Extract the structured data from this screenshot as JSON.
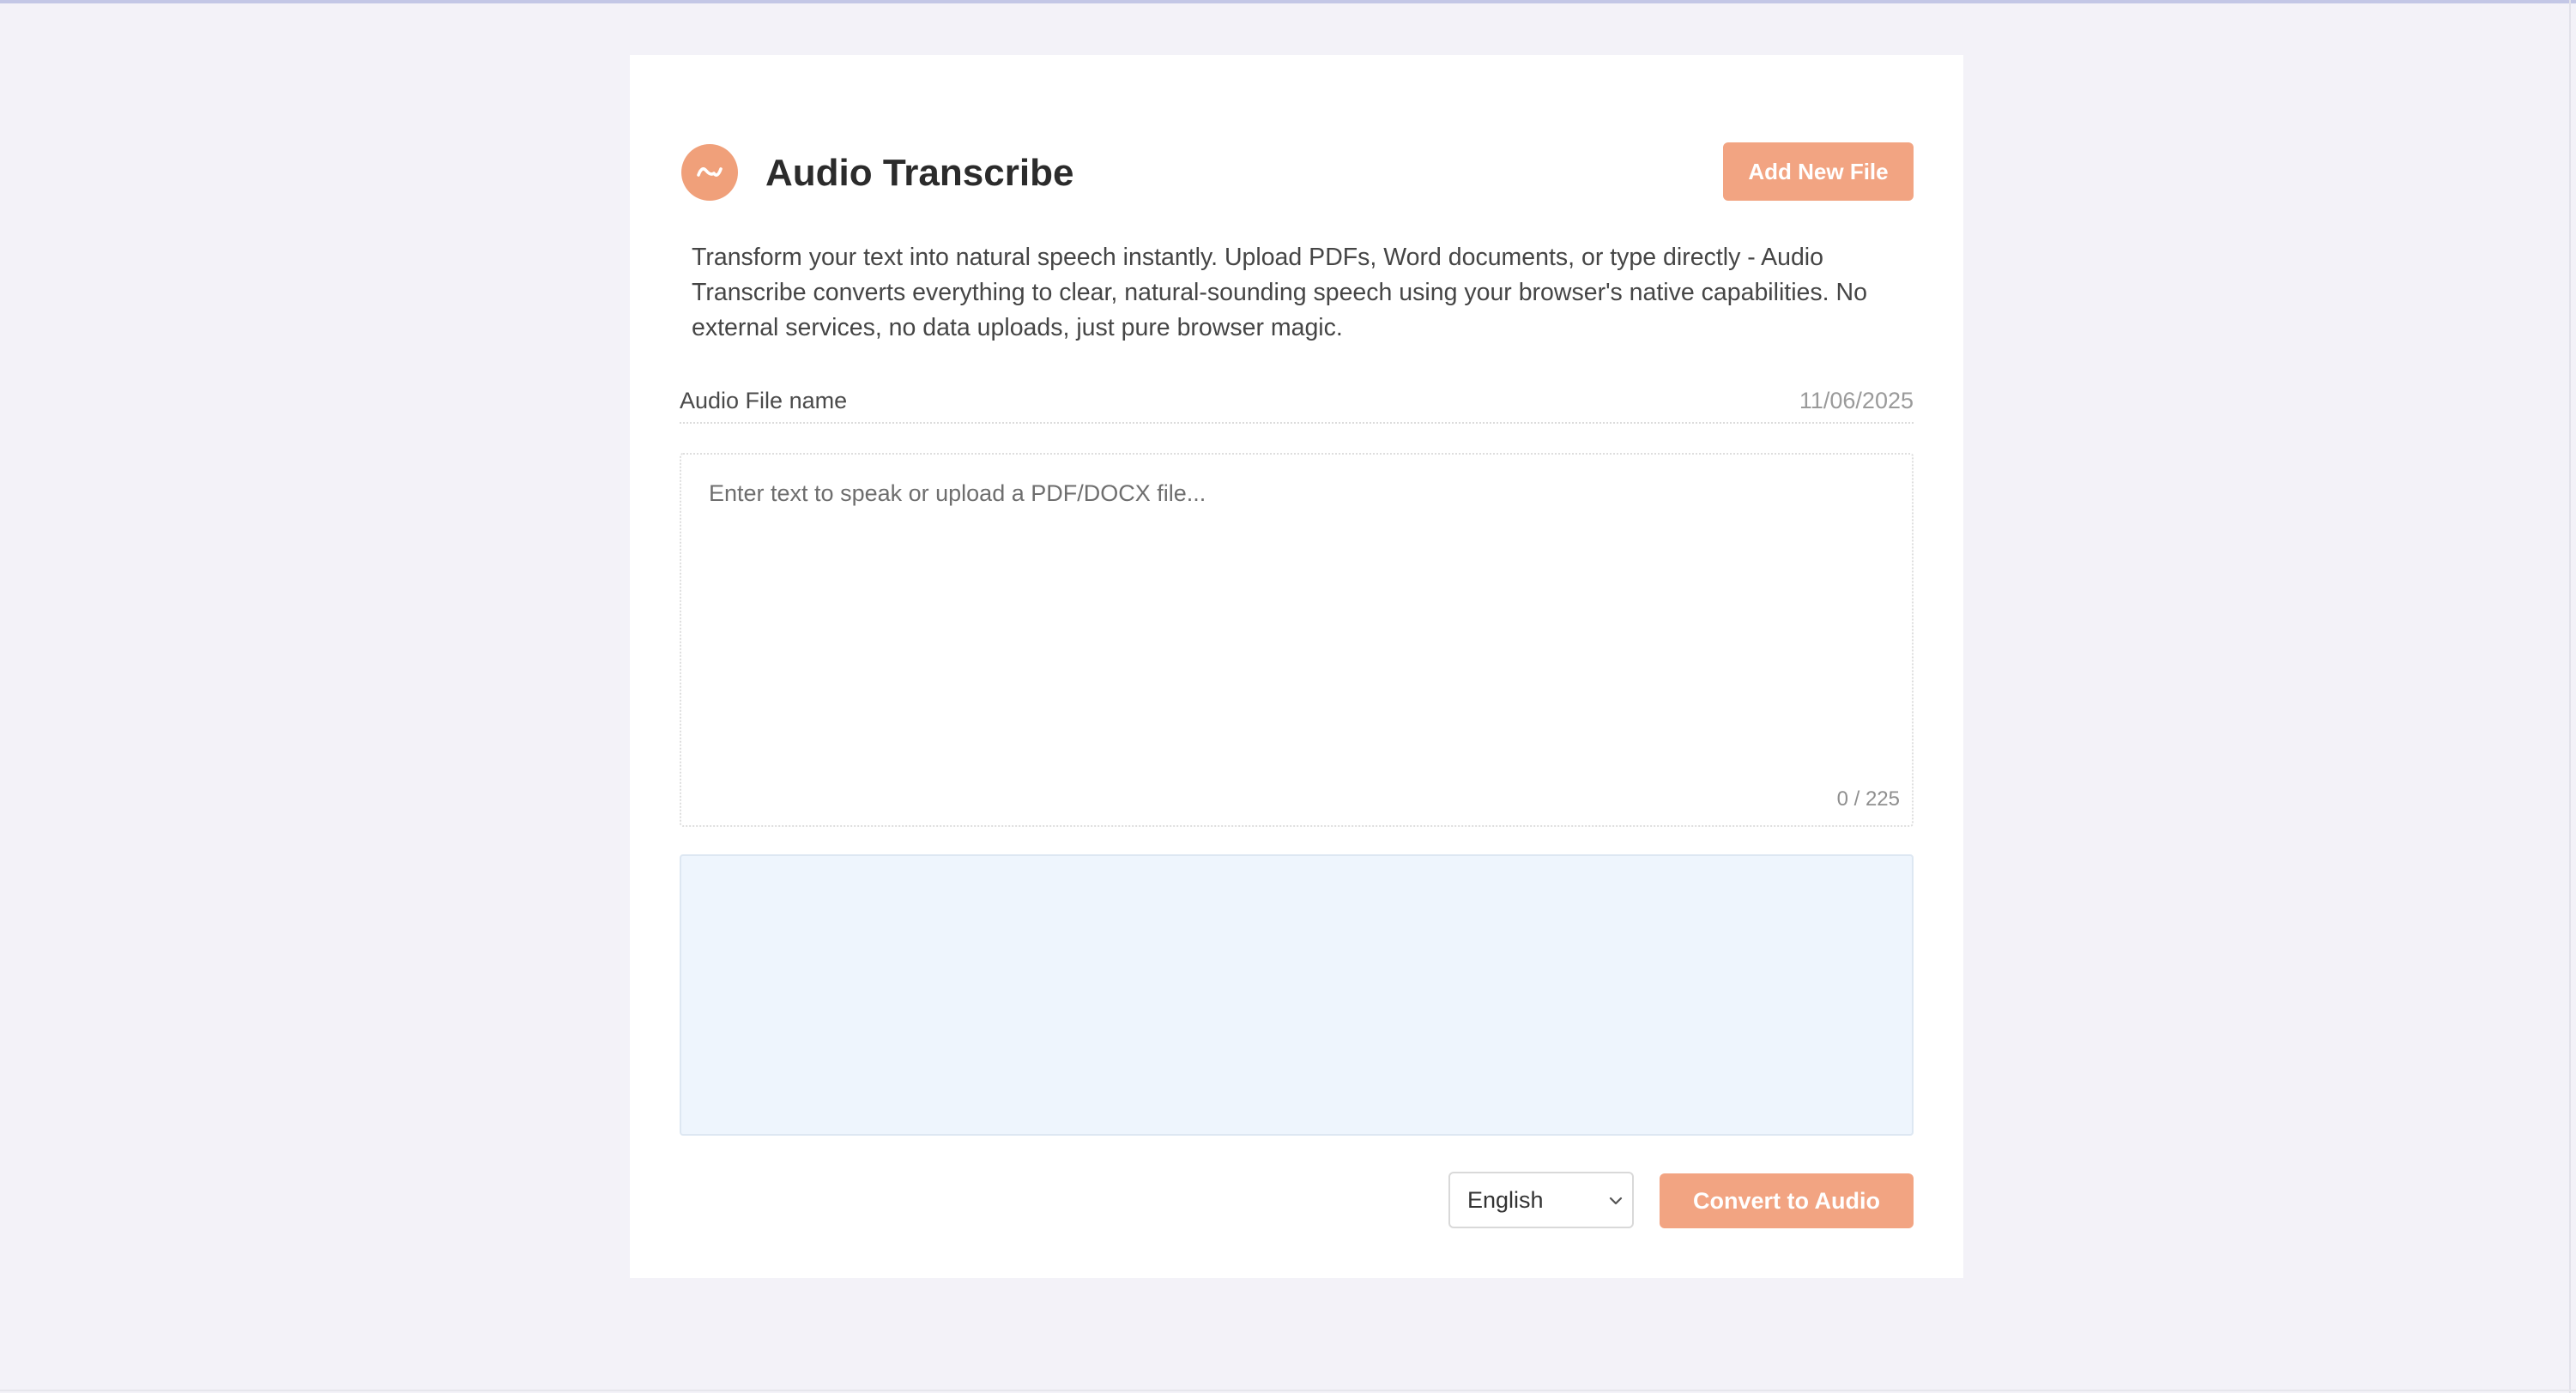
{
  "app": {
    "title": "Audio Transcribe",
    "logo_icon": "waveform-icon",
    "accent_color": "#f2a482"
  },
  "header": {
    "add_button_label": "Add New File"
  },
  "description": "Transform your text into natural speech instantly. Upload PDFs, Word documents, or type directly - Audio Transcribe converts everything to clear, natural-sounding speech using your browser's native capabilities. No external services, no data uploads, just pure browser magic.",
  "file": {
    "name_label": "Audio File name",
    "date": "11/06/2025"
  },
  "editor": {
    "placeholder": "Enter text to speak or upload a PDF/DOCX file...",
    "value": "",
    "char_count": "0 / 225"
  },
  "audio_panel": {
    "background_color": "#eef5fd"
  },
  "controls": {
    "language": {
      "selected": "English",
      "icon": "chevron-down-icon"
    },
    "convert_button_label": "Convert to Audio"
  }
}
